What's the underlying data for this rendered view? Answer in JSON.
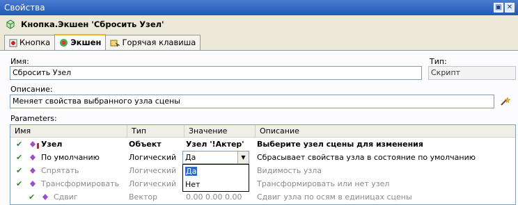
{
  "window": {
    "title": "Свойства",
    "buttons": [
      "▣",
      "✕"
    ]
  },
  "header": {
    "title": "Кнопка.Экшен 'Сбросить Узел'",
    "icon": "action-icon"
  },
  "tabs": [
    {
      "label": "Кнопка",
      "icon": "button-icon",
      "active": false
    },
    {
      "label": "Экшен",
      "icon": "action-icon",
      "active": true
    },
    {
      "label": "Горячая клавиша",
      "icon": "hotkey-icon",
      "active": false
    }
  ],
  "form": {
    "name_label": "Имя:",
    "name_value": "Сбросить Узел",
    "type_label": "Тип:",
    "type_value": "Скрипт",
    "desc_label": "Описание:",
    "desc_value": "Меняет свойства выбранного узла сцены",
    "params_label": "Parameters:"
  },
  "table": {
    "columns": [
      "Имя",
      "Тип",
      "Значение",
      "Описание"
    ],
    "rows": [
      {
        "name": "Узел",
        "type": "Объект",
        "value": "Узел '!Актер'",
        "desc": "Выберите узел сцены для изменения",
        "bold": true,
        "dim": false
      },
      {
        "name": "По умолчанию",
        "type": "Логический",
        "value": "Да",
        "desc": "Сбрасывает свойства узла в состояние по умолчанию",
        "bold": false,
        "dim": false
      },
      {
        "name": "Спрятать",
        "type": "Логический",
        "value": "",
        "desc": "Видимость узла",
        "bold": false,
        "dim": true
      },
      {
        "name": "Трансформировать",
        "type": "Логический",
        "value": "",
        "desc": "Трансформировать или нет узел",
        "bold": false,
        "dim": true
      },
      {
        "name": "Сдвиг",
        "type": "Вектор",
        "value": "0.00  0.00  0.00",
        "desc": "Сдвиг узла по осям в единицах сцены",
        "bold": false,
        "dim": true
      }
    ]
  },
  "dropdown": {
    "selected": "Да",
    "options": [
      "Да",
      "Нет"
    ]
  }
}
